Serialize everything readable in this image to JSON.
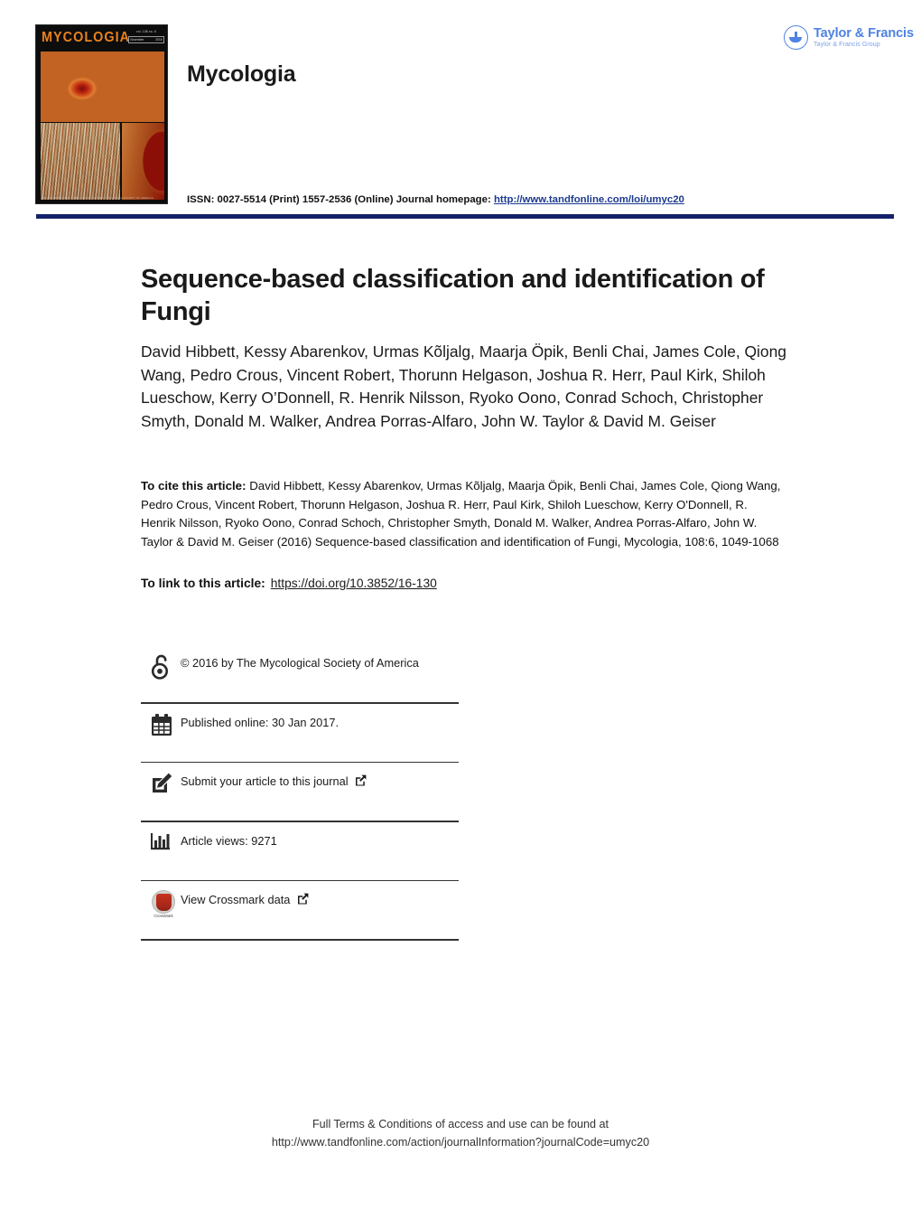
{
  "header": {
    "journal_name": "Mycologia",
    "cover": {
      "masthead_title": "MYCOLOGIA",
      "volume_line": "vol. 108 no. 6",
      "date_month": "November",
      "date_year": "2016",
      "footer_line": "OFFICIAL BIMONTHLY PUBLICATION OF THE MYCOLOGICAL SOCIETY OF AMERICA",
      "alt": "Mycologia journal cover, orange cup fungi on green moss"
    },
    "publisher": {
      "name": "Taylor & Francis",
      "group": "Taylor & Francis Group",
      "brand_color": "#4e82e3"
    },
    "issn": {
      "prefix": "ISSN: 0027-5514 (Print) 1557-2536 (Online) Journal homepage: ",
      "homepage_url": "http://www.tandfonline.com/loi/umyc20"
    },
    "rule_color": "#15226b"
  },
  "article": {
    "title": "Sequence-based classification and identification of Fungi",
    "authors": "David Hibbett, Kessy Abarenkov, Urmas Kõljalg, Maarja Öpik, Benli Chai, James Cole, Qiong Wang, Pedro Crous, Vincent Robert, Thorunn Helgason, Joshua R. Herr, Paul Kirk, Shiloh Lueschow, Kerry O’Donnell, R. Henrik Nilsson, Ryoko Oono, Conrad Schoch, Christopher Smyth, Donald M. Walker, Andrea Porras-Alfaro, John W. Taylor & David M. Geiser",
    "cite_label": "To cite this article:",
    "cite_text": " David Hibbett, Kessy Abarenkov, Urmas Kõljalg, Maarja Öpik, Benli Chai, James Cole, Qiong Wang, Pedro Crous, Vincent Robert, Thorunn Helgason, Joshua R. Herr, Paul Kirk, Shiloh Lueschow, Kerry O'Donnell, R. Henrik Nilsson, Ryoko Oono, Conrad Schoch, Christopher Smyth, Donald M. Walker, Andrea Porras-Alfaro, John W. Taylor & David M. Geiser (2016) Sequence-based classification and identification of Fungi, Mycologia, 108:6, 1049-1068",
    "link_label": "To link to this article:",
    "doi_url": "https://doi.org/10.3852/16-130"
  },
  "meta_rows": [
    {
      "icon": "open-access-icon",
      "text": "© 2016 by The Mycological Society of America",
      "external": false
    },
    {
      "icon": "calendar-icon",
      "text": "Published online: 30 Jan 2017.",
      "external": false
    },
    {
      "icon": "pencil-icon",
      "text": "Submit your article to this journal",
      "external": true
    },
    {
      "icon": "bar-chart-icon",
      "text": "Article views: 9271",
      "external": false
    },
    {
      "icon": "crossmark-icon",
      "text": "View Crossmark data",
      "external": true,
      "badge_label": "CrossMark"
    }
  ],
  "footer": {
    "line1": "Full Terms & Conditions of access and use can be found at",
    "line2": "http://www.tandfonline.com/action/journalInformation?journalCode=umyc20"
  }
}
